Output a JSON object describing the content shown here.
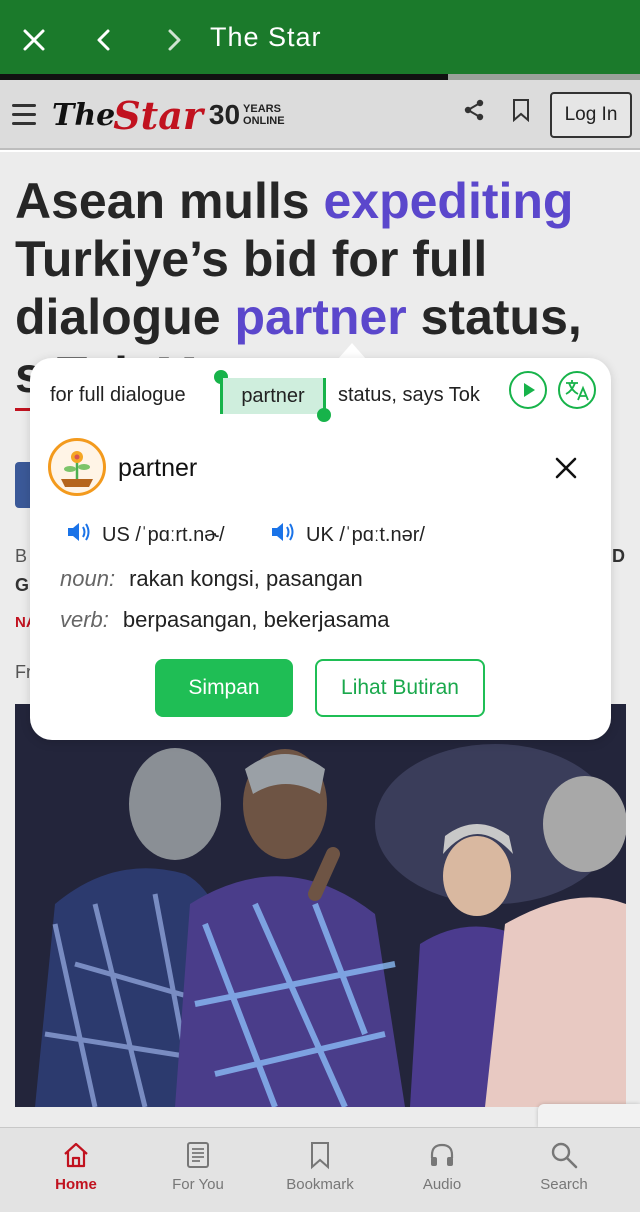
{
  "appbar": {
    "title": "The Star",
    "progress": 0.7
  },
  "site": {
    "logo_the": "The",
    "logo_star": "Star",
    "logo_years": "30",
    "logo_sub1": "YEARS",
    "logo_sub2": "ONLINE",
    "login_label": "Log In"
  },
  "article": {
    "headline_1a": "Asean mulls ",
    "headline_1b": "expediting",
    "headline_2": "Turkiye’s bid for full",
    "headline_3a": "dialogue ",
    "headline_3b": "partner",
    "headline_3c": " status,",
    "headline_4": "s     Tok M",
    "stub_byline": "B",
    "stub_g": "G",
    "stub_na": "NA",
    "stub_fr": "Fr",
    "stub_d": "D"
  },
  "popup": {
    "context_before": "for full dialogue",
    "context_word": "partner",
    "context_after": "status, says Tok",
    "word": "partner",
    "us_label": "US",
    "us_ipa": "/ˈpɑːrt.nɚ/",
    "uk_label": "UK",
    "uk_ipa": "/ˈpɑːt.nər/",
    "defs": [
      {
        "pos": "noun:",
        "text": "rakan kongsi, pasangan"
      },
      {
        "pos": "verb:",
        "text": "berpasangan, bekerjasama"
      }
    ],
    "save_label": "Simpan",
    "detail_label": "Lihat Butiran"
  },
  "bottom_nav": [
    {
      "label": "Home",
      "icon": "home-icon",
      "active": true
    },
    {
      "label": "For You",
      "icon": "news-icon",
      "active": false
    },
    {
      "label": "Bookmark",
      "icon": "bookmark-icon",
      "active": false
    },
    {
      "label": "Audio",
      "icon": "headphones-icon",
      "active": false
    },
    {
      "label": "Search",
      "icon": "search-icon",
      "active": false
    }
  ],
  "colors": {
    "appbar": "#1b7a2b",
    "accent_green": "#1fbe55",
    "brand_red": "#c1121f",
    "headline_highlight": "#5b47cc"
  }
}
